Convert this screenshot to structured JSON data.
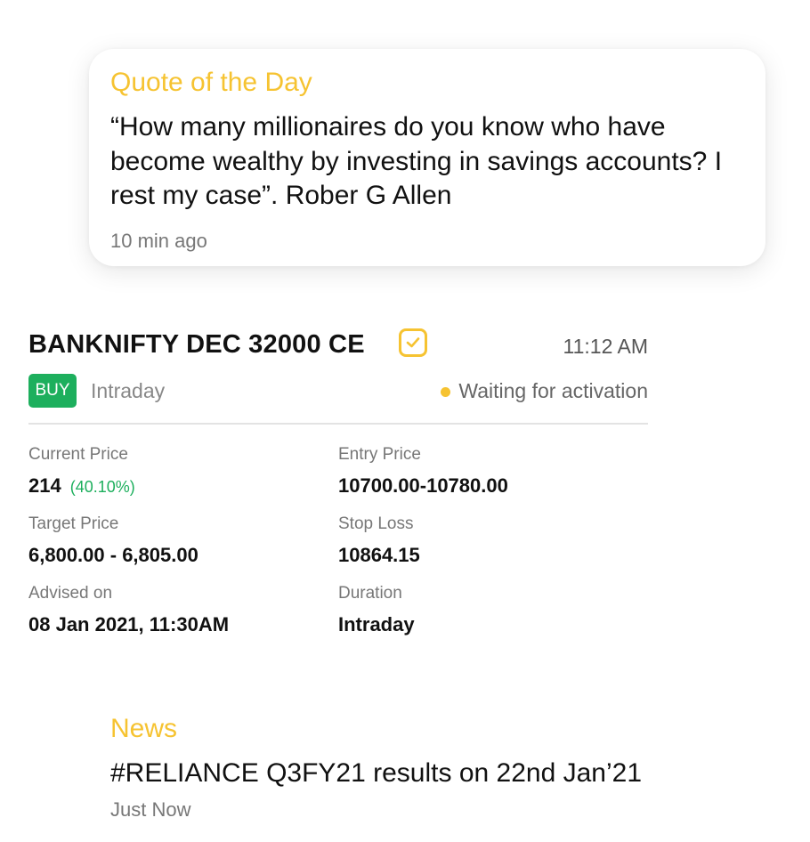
{
  "quote": {
    "heading": "Quote of the Day",
    "text": "“How many millionaires do you know who have become wealthy by investing in savings accounts? I rest my case”. Rober G Allen",
    "time": "10 min ago"
  },
  "trade": {
    "symbol": "BANKNIFTY DEC 32000 CE",
    "check_icon": "check-square-icon",
    "time": "11:12 AM",
    "action": "BUY",
    "type": "Intraday",
    "status": "Waiting for activation",
    "details": {
      "current_price_label": "Current Price",
      "current_price": "214",
      "current_change": "(40.10%)",
      "entry_price_label": "Entry Price",
      "entry_price": "10700.00-10780.00",
      "target_price_label": "Target Price",
      "target_price": "6,800.00 - 6,805.00",
      "stop_loss_label": "Stop Loss",
      "stop_loss": "10864.15",
      "advised_on_label": "Advised on",
      "advised_on": "08 Jan 2021, 11:30AM",
      "duration_label": "Duration",
      "duration": "Intraday"
    }
  },
  "news": {
    "heading": "News",
    "text": "#RELIANCE Q3FY21 results on 22nd Jan’21",
    "time": "Just Now"
  },
  "colors": {
    "accent": "#F6C331",
    "buy": "#1DAF5D",
    "positive": "#1DAF5D"
  }
}
